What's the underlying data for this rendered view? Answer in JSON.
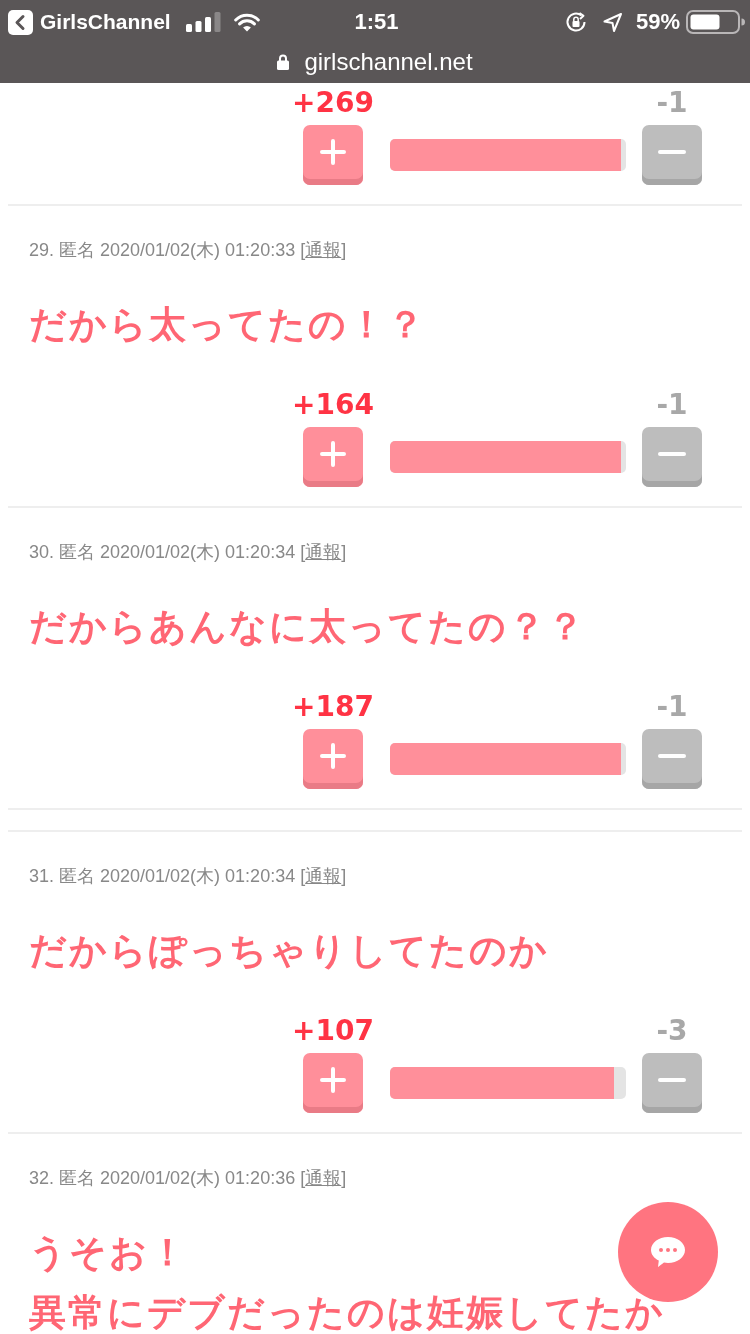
{
  "status_bar": {
    "back_label": "GirlsChannel",
    "time": "1:51",
    "battery": "59%",
    "url": "girlschannel.net"
  },
  "comments": [
    {
      "kind": "comment",
      "votes": {
        "plus": "+269",
        "minus": "-1",
        "level": 0.98
      }
    },
    {
      "kind": "comment",
      "meta": "29. 匿名 2020/01/02(木) 01:20:33",
      "report_open": "[",
      "report_link": "通報",
      "report_close": "]",
      "body": [
        "だから太ってたの！？"
      ],
      "votes": {
        "plus": "+164",
        "minus": "-1",
        "level": 0.98
      }
    },
    {
      "kind": "comment",
      "meta": "30. 匿名 2020/01/02(木) 01:20:34",
      "report_open": "[",
      "report_link": "通報",
      "report_close": "]",
      "body": [
        "だからあんなに太ってたの？？"
      ],
      "votes": {
        "plus": "+187",
        "minus": "-1",
        "level": 0.98
      }
    },
    {
      "kind": "separator"
    },
    {
      "kind": "comment",
      "meta": "31. 匿名 2020/01/02(木) 01:20:34",
      "report_open": "[",
      "report_link": "通報",
      "report_close": "]",
      "body": [
        "だからぽっちゃりしてたのか"
      ],
      "votes": {
        "plus": "+107",
        "minus": "-3",
        "level": 0.95
      }
    },
    {
      "kind": "comment",
      "meta": "32. 匿名 2020/01/02(木) 01:20:36",
      "report_open": "[",
      "report_link": "通報",
      "report_close": "]",
      "body": [
        "うそお！",
        "異常にデブだったのは妊娠してたか"
      ]
    }
  ]
}
